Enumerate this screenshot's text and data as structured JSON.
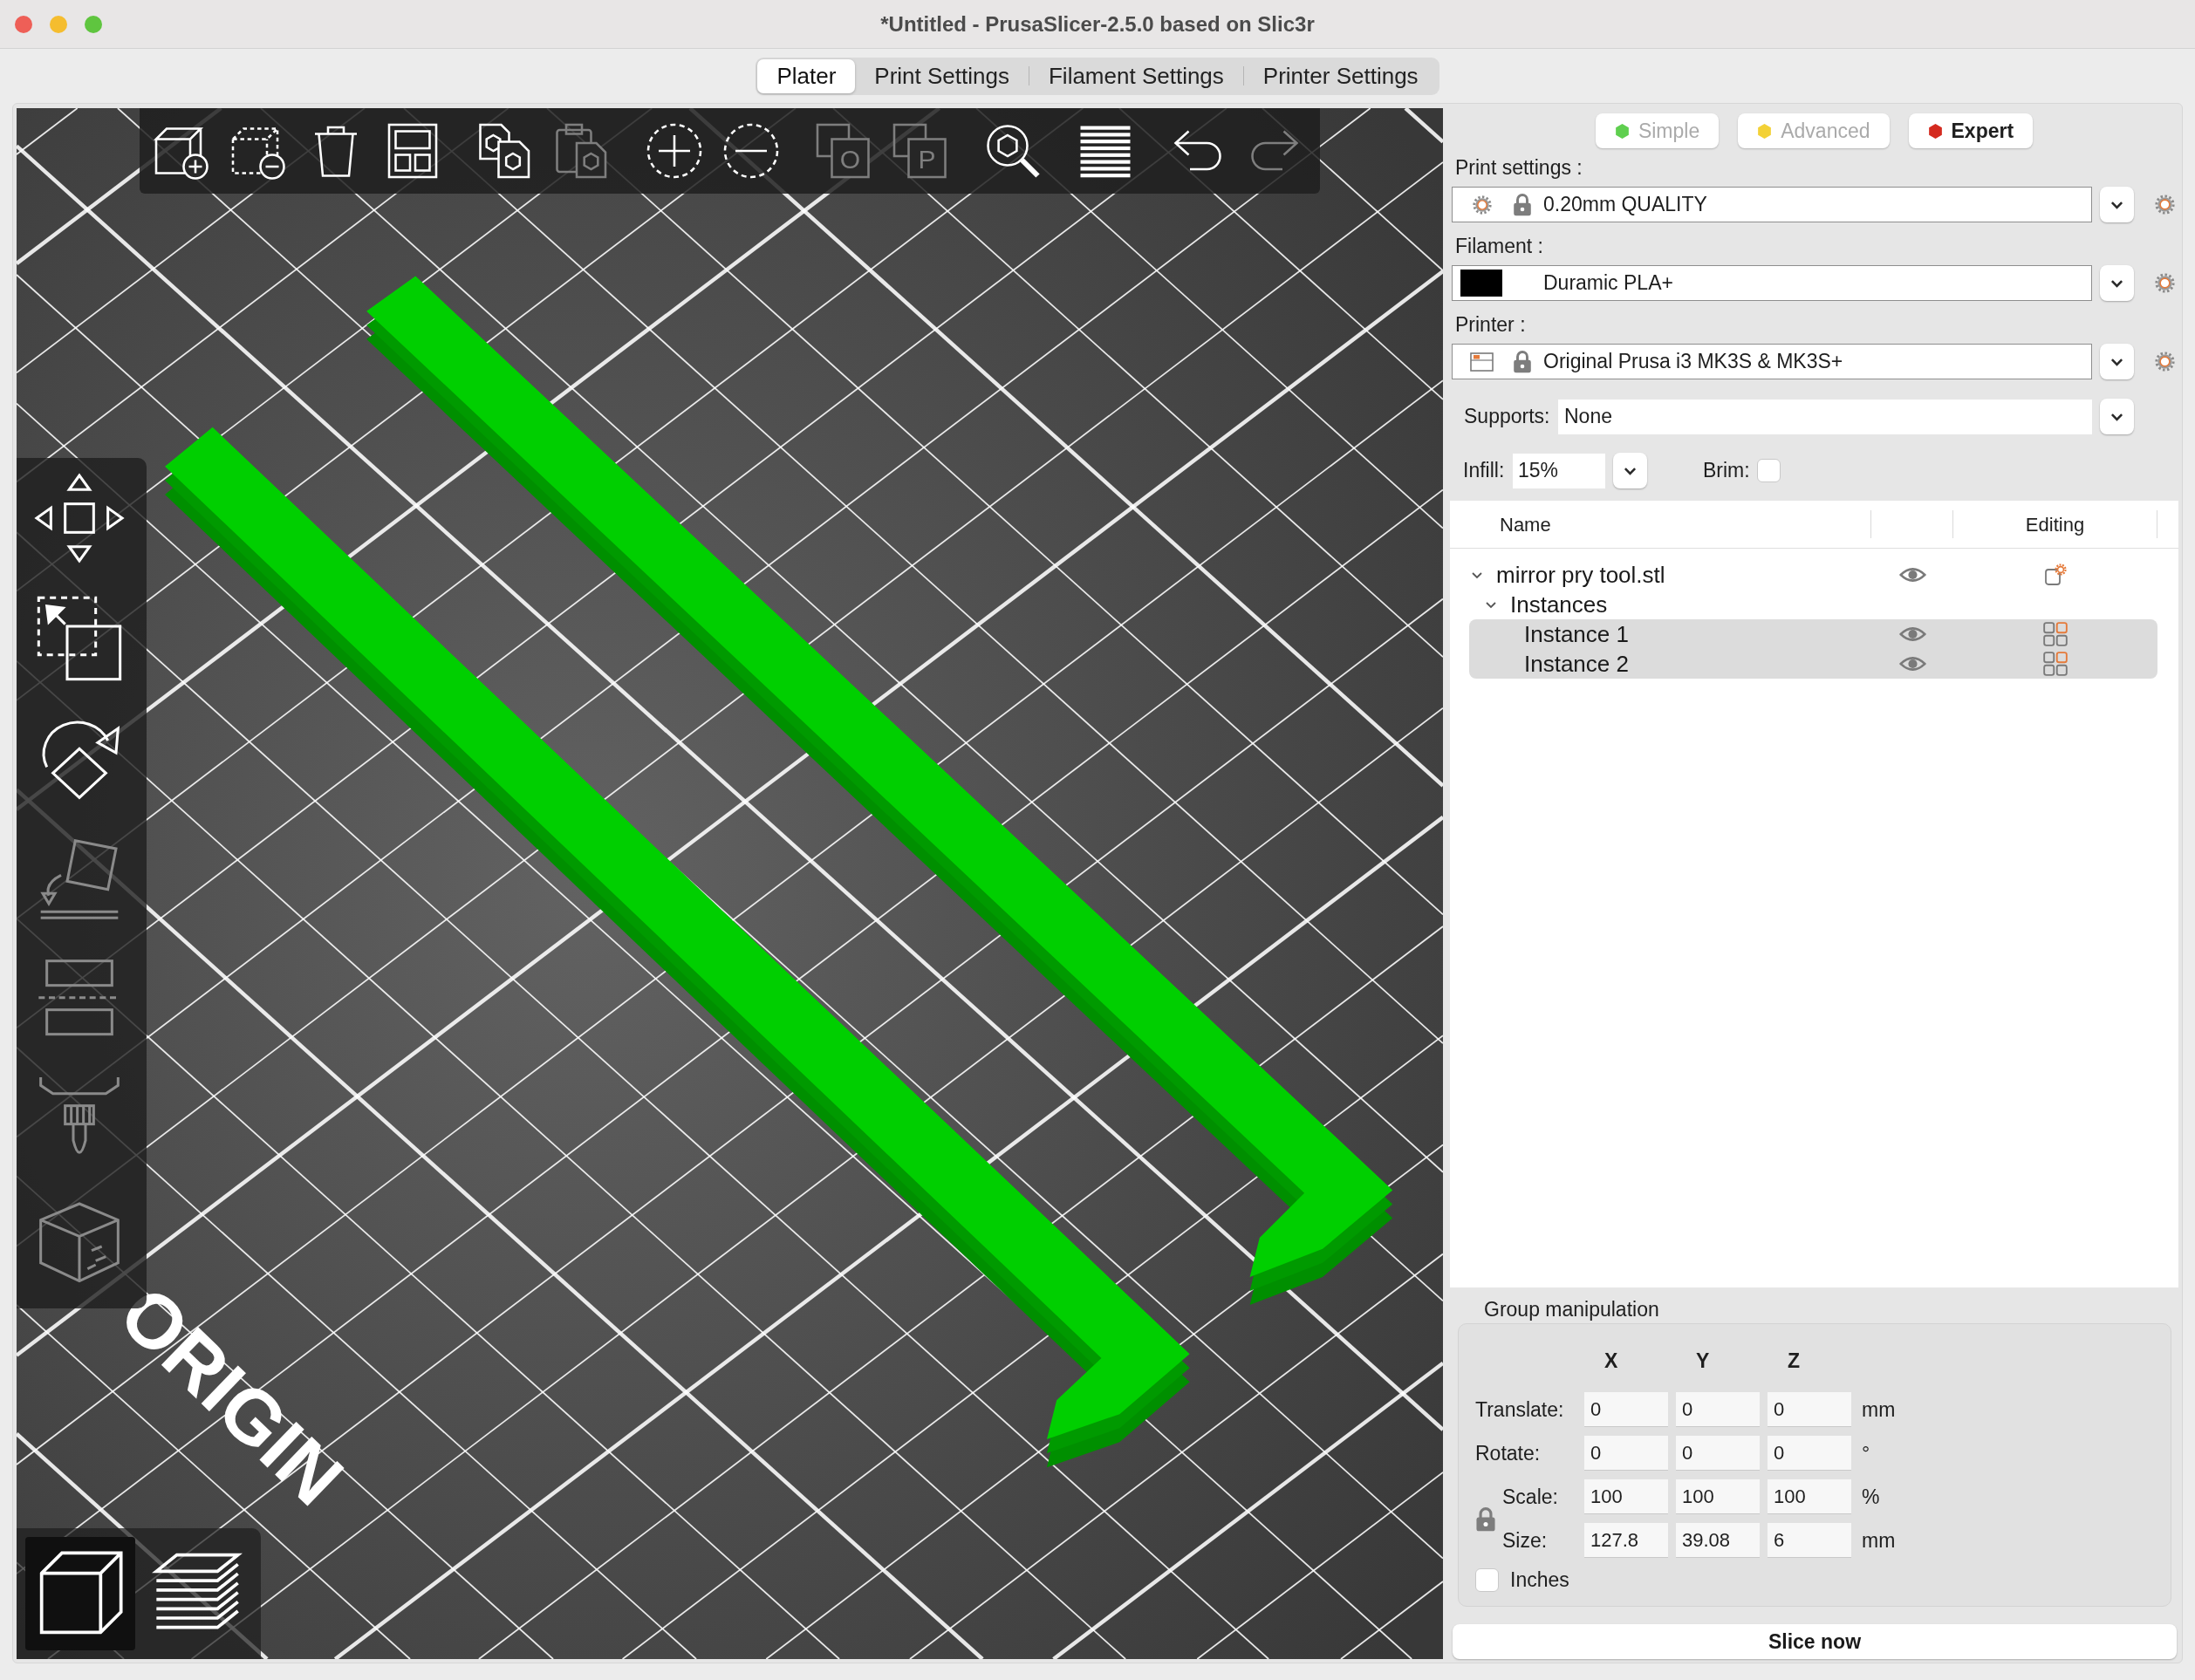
{
  "window": {
    "title": "*Untitled - PrusaSlicer-2.5.0 based on Slic3r"
  },
  "tabs": [
    {
      "label": "Plater",
      "selected": true
    },
    {
      "label": "Print Settings",
      "selected": false
    },
    {
      "label": "Filament Settings",
      "selected": false
    },
    {
      "label": "Printer Settings",
      "selected": false
    }
  ],
  "viewport": {
    "bed_label": "ORIGIN",
    "top_toolbar": [
      {
        "kind": "add",
        "disabled": false
      },
      {
        "kind": "delete",
        "disabled": false
      },
      {
        "kind": "delete_all",
        "disabled": false
      },
      {
        "kind": "arrange",
        "disabled": false
      },
      {
        "kind": "copy",
        "disabled": false
      },
      {
        "kind": "paste",
        "disabled": true
      },
      {
        "kind": "add_instance",
        "disabled": false
      },
      {
        "kind": "remove_instance",
        "disabled": false
      },
      {
        "kind": "split_objects",
        "disabled": true,
        "letter": "O"
      },
      {
        "kind": "split_parts",
        "disabled": true,
        "letter": "P"
      },
      {
        "kind": "search",
        "disabled": false
      },
      {
        "kind": "layers",
        "disabled": false
      },
      {
        "kind": "undo",
        "disabled": false
      },
      {
        "kind": "redo",
        "disabled": true
      }
    ],
    "gizmo_toolbar": [
      {
        "kind": "move",
        "disabled": false
      },
      {
        "kind": "scale",
        "disabled": false
      },
      {
        "kind": "rotate",
        "disabled": false
      },
      {
        "kind": "place",
        "disabled": true
      },
      {
        "kind": "cut",
        "disabled": true
      },
      {
        "kind": "paint",
        "disabled": true
      },
      {
        "kind": "seam",
        "disabled": true
      }
    ],
    "view_toolbar": [
      {
        "kind": "model",
        "selected": true
      },
      {
        "kind": "preview",
        "selected": false
      }
    ]
  },
  "sidebar": {
    "modes": [
      {
        "label": "Simple",
        "color": "#5fcf4f",
        "selected": false
      },
      {
        "label": "Advanced",
        "color": "#f3d136",
        "selected": false
      },
      {
        "label": "Expert",
        "color": "#d42a1f",
        "selected": true
      }
    ],
    "presets": [
      {
        "kind": "print",
        "label": "Print settings :",
        "value": "0.20mm QUALITY",
        "locked": true
      },
      {
        "kind": "filament",
        "label": "Filament :",
        "value": "Duramic PLA+",
        "color": "#000000",
        "locked": false
      },
      {
        "kind": "printer",
        "label": "Printer :",
        "value": "Original Prusa i3 MK3S & MK3S+",
        "locked": true
      }
    ],
    "supports": {
      "label": "Supports:",
      "value": "None"
    },
    "infill": {
      "label": "Infill:",
      "value": "15%"
    },
    "brim": {
      "label": "Brim:",
      "checked": false
    },
    "object_list": {
      "columns": [
        "Name",
        "Editing"
      ],
      "items": [
        {
          "kind": "object",
          "label": "mirror pry tool.stl",
          "expanded": true,
          "selected": false,
          "children": [
            {
              "kind": "instances",
              "label": "Instances",
              "expanded": true,
              "selected": false,
              "children": [
                {
                  "kind": "instance",
                  "label": "Instance 1",
                  "selected": true
                },
                {
                  "kind": "instance",
                  "label": "Instance 2",
                  "selected": true
                }
              ]
            }
          ]
        }
      ]
    },
    "manipulation": {
      "title": "Group manipulation",
      "axes": [
        "X",
        "Y",
        "Z"
      ],
      "rows": [
        {
          "kind": "transform",
          "label": "Translate:",
          "values": [
            "0",
            "0",
            "0"
          ],
          "unit": "mm"
        },
        {
          "kind": "transform",
          "label": "Rotate:",
          "values": [
            "0",
            "0",
            "0"
          ],
          "unit": "°"
        },
        {
          "kind": "scaling",
          "label": "Scale:",
          "values": [
            "100",
            "100",
            "100"
          ],
          "unit": "%"
        },
        {
          "kind": "scaling",
          "label": "Size:",
          "values": [
            "127.8",
            "39.08",
            "6"
          ],
          "unit": "mm"
        }
      ],
      "scale_locked": true,
      "inches": {
        "label": "Inches",
        "checked": false
      }
    },
    "slice_button": "Slice now"
  }
}
